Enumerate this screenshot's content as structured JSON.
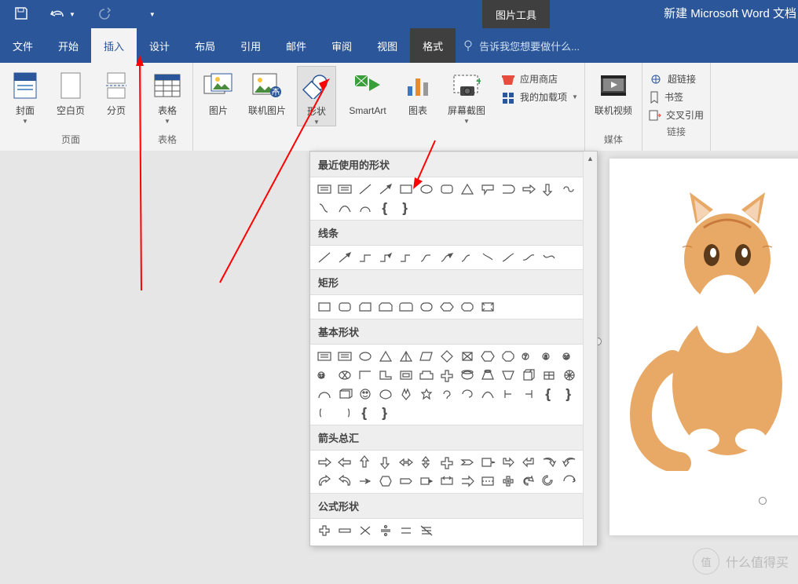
{
  "window": {
    "title": "新建 Microsoft Word 文档",
    "context_tab": "图片工具",
    "tellme_placeholder": "告诉我您想要做什么..."
  },
  "tabs": {
    "file": "文件",
    "home": "开始",
    "insert": "插入",
    "design": "设计",
    "layout": "布局",
    "references": "引用",
    "mailings": "邮件",
    "review": "审阅",
    "view": "视图",
    "format": "格式"
  },
  "ribbon": {
    "pages": {
      "label": "页面",
      "cover": "封面",
      "blank": "空白页",
      "break": "分页"
    },
    "tables": {
      "label": "表格",
      "table": "表格"
    },
    "illustrations": {
      "pictures": "图片",
      "online_pics": "联机图片",
      "shapes": "形状",
      "smartart": "SmartArt",
      "chart": "图表",
      "screenshot": "屏幕截图"
    },
    "addins": {
      "store": "应用商店",
      "myaddins": "我的加载项"
    },
    "media": {
      "label": "媒体",
      "video": "联机视频"
    },
    "links": {
      "label": "链接",
      "hyperlink": "超链接",
      "bookmark": "书签",
      "crossref": "交叉引用"
    }
  },
  "shape_cats": {
    "recent": "最近使用的形状",
    "lines": "线条",
    "rects": "矩形",
    "basic": "基本形状",
    "arrows": "箭头总汇",
    "equation": "公式形状"
  },
  "watermark": "什么值得买"
}
